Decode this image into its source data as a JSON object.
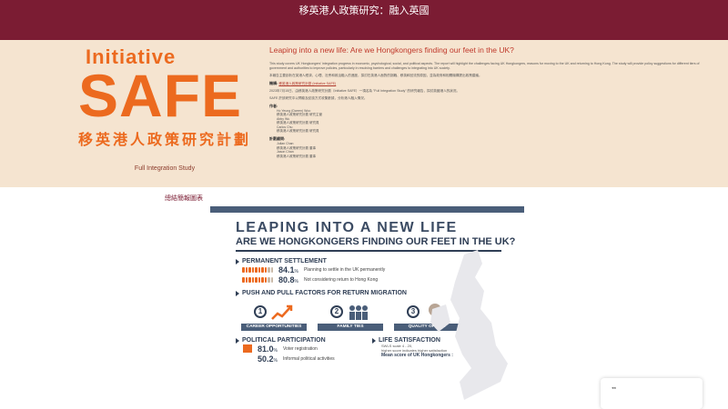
{
  "header": {
    "title": "移英港人政策研究：融入英國"
  },
  "logo": {
    "initiative": "Initiative",
    "safe": "SAFE",
    "chinese": "移英港人政策研究計劃",
    "subtitle": "Full Integration Study"
  },
  "article": {
    "heading": "Leaping into a new life: Are we Hongkongers finding our feet in the UK?",
    "intro_en": "This study covers UK Hongkongers' integration progress in economic, psychological, social, and political aspects. The report will highlight the challenges facing UK Hongkongers, reasons for moving to the UK and returning to Hong Kong. The study will provide policy suggestions for different tiers of government and authorities to improve policies, particularly in resolving barriers and challenges to integrating into UK society.",
    "intro_zh": "本報告主要剖析在英港人經濟、心理、社會和政治融入的進度，探討在英港人面對的挑戰、移英和回流的原因，並為政府和相關機構提出政策建議。",
    "org_label": "機構:",
    "org_link": "移英港人政策研究計劃 (Initiative SAFE)",
    "date_line": "2023年7月15日，由移英港人政策研究計劃（Initiative SAFE）一項名為 \"Full Integration Study\" 的研究報告，探討英國港人的狀況。",
    "method_line": "SAFE 於該研究中以問卷及訪談方式收集數據，分析港人融入情況。",
    "authors_label": "作者:",
    "authors": [
      "Ho Yeung (Darren) Woo",
      "移英港人政策研究計劃 研究主管",
      "Abby Wu",
      "移英港人政策研究計劃 研究員",
      "Carlos Chu",
      "移英港人政策研究計劃 研究員"
    ],
    "advisors_label": "計劃顧問:",
    "advisors": [
      "Julian Chan",
      "移英港人政策研究計劃 董事",
      "Jason Chan",
      "移英港人政策研究計劃 董事"
    ]
  },
  "caption": "總結簡報圖表",
  "poster": {
    "title1": "LEAPING INTO A NEW LIFE",
    "title2": "ARE WE HONGKONGERS FINDING OUR FEET IN THE UK?",
    "permanent": {
      "heading": "PERMANENT SETTLEMENT",
      "rows": [
        {
          "pct": "84.1",
          "text": "Planning to settle in the UK permanently",
          "fill": 0.841
        },
        {
          "pct": "80.8",
          "text": "Not considering return to Hong Kong",
          "fill": 0.808
        }
      ]
    },
    "factors": {
      "heading": "PUSH AND PULL FACTORS FOR RETURN MIGRATION",
      "items": [
        {
          "num": "1",
          "label": "CAREER OPPORTUNITIES"
        },
        {
          "num": "2",
          "label": "FAMILY TIES"
        },
        {
          "num": "3",
          "label": "QUALITY OF LIFE"
        }
      ]
    },
    "political": {
      "heading": "POLITICAL PARTICIPATION",
      "rows": [
        {
          "pct": "81.0",
          "text": "Voter registration"
        },
        {
          "pct": "50.2",
          "text": "Informal political activities"
        }
      ]
    },
    "life": {
      "heading": "LIFE SATISFACTION",
      "line1": "SWLS scale 4 - 20,",
      "line2": "higher score indicates higher satisfaction",
      "mean": "Mean score of UK Hongkongers :"
    }
  },
  "popup": {
    "text": "◂◂"
  },
  "colors": {
    "maroon": "#7b1c33",
    "orange": "#ec6a1f",
    "navy": "#2f3e55",
    "beige": "#f5e4d0"
  }
}
